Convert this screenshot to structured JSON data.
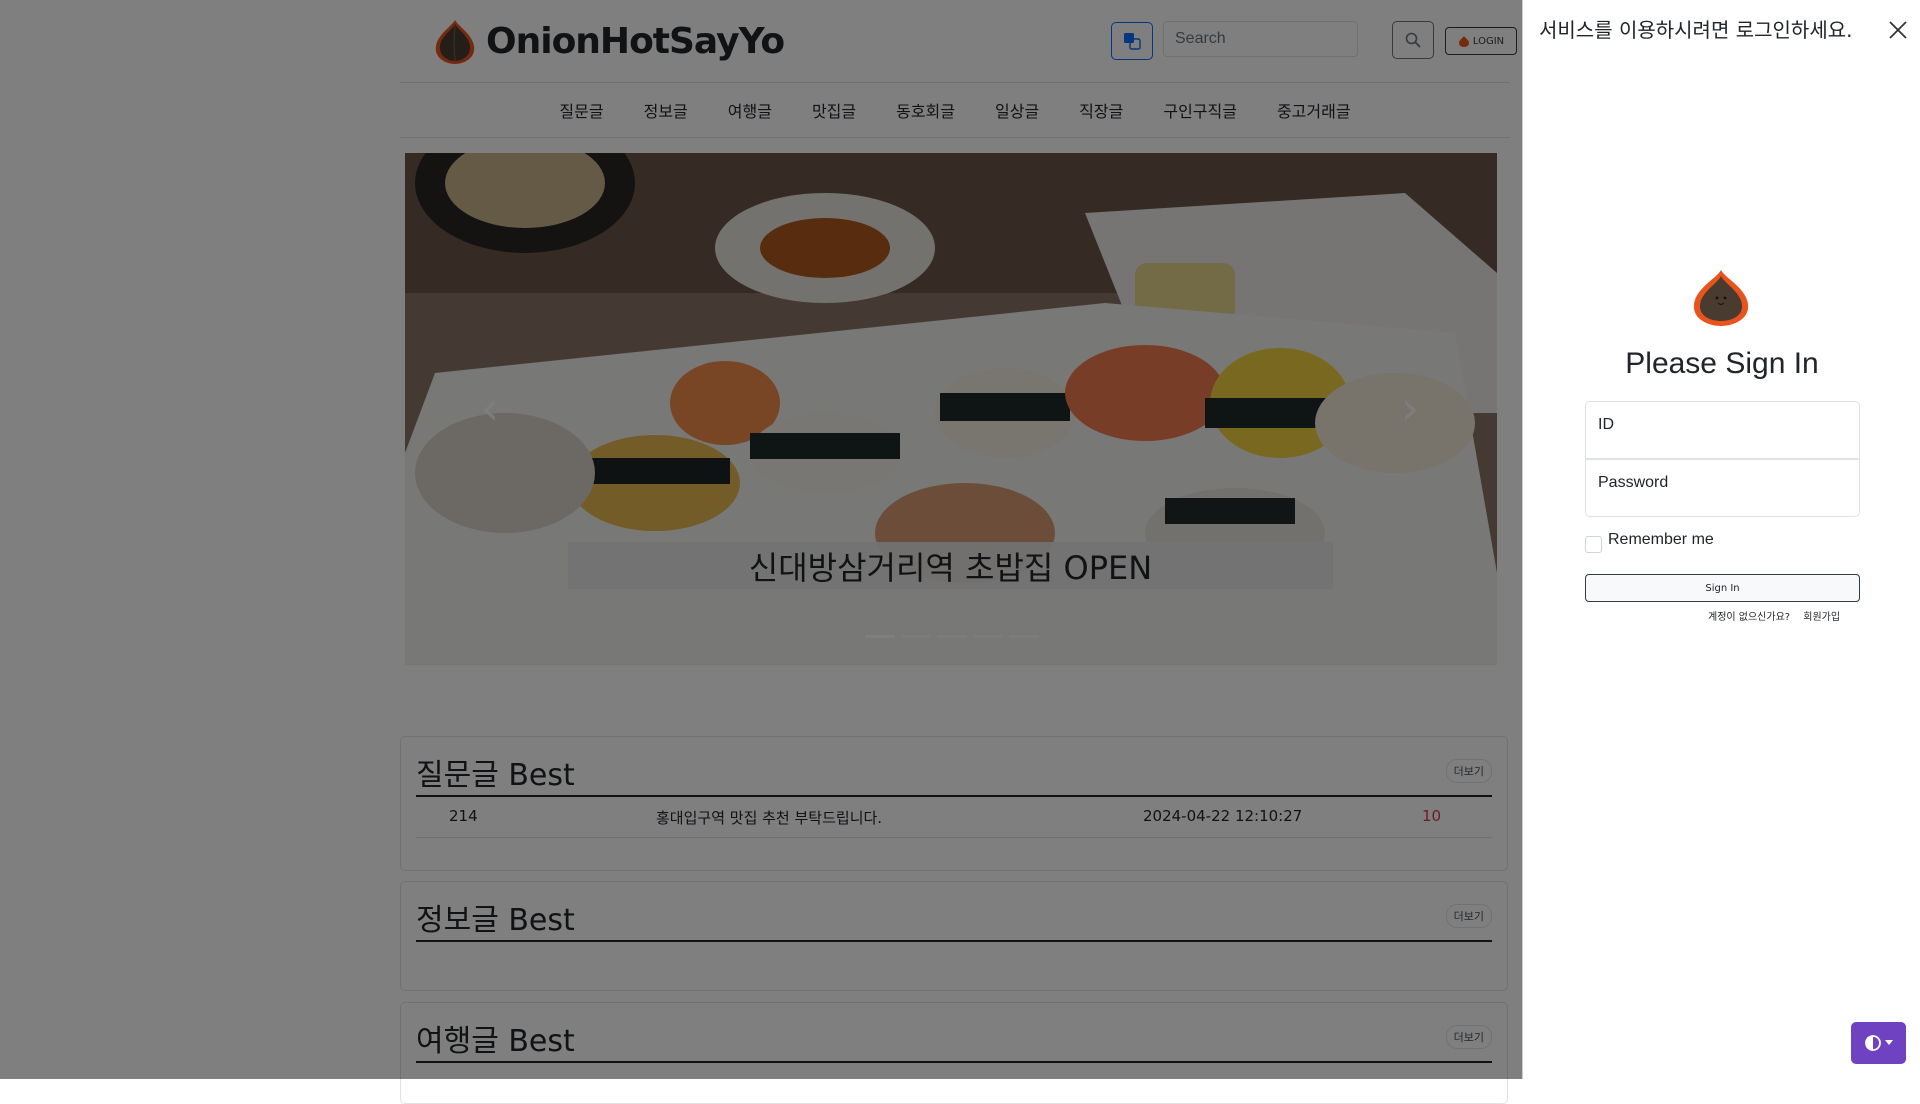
{
  "header": {
    "site_name": "OnionHotSayYo",
    "search_placeholder": "Search",
    "login_label": "LOGIN"
  },
  "nav": {
    "items": [
      "질문글",
      "정보글",
      "여행글",
      "맛집글",
      "동호회글",
      "일상글",
      "직장글",
      "구인구직글",
      "중고거래글"
    ]
  },
  "carousel": {
    "caption": "신대방삼거리역 초밥집 OPEN",
    "slide_count": 5,
    "active_index": 0
  },
  "sections": [
    {
      "title": "질문글 Best",
      "more_label": "더보기",
      "rows": [
        {
          "id": "214",
          "title": "홍대입구역 맛집 추천 부탁드립니다.",
          "date": "2024-04-22 12:10:27",
          "count": "10"
        }
      ]
    },
    {
      "title": "정보글 Best",
      "more_label": "더보기",
      "rows": []
    },
    {
      "title": "여행글 Best",
      "more_label": "더보기",
      "rows": []
    }
  ],
  "offcanvas": {
    "title": "서비스를 이용하시려면 로그인하세요.",
    "heading": "Please Sign In",
    "id_label": "ID",
    "password_label": "Password",
    "remember_label": "Remember me",
    "signin_label": "Sign In",
    "no_account_text": "계정이 없으신가요?",
    "signup_label": "회원가입"
  },
  "colors": {
    "accent_blue": "#0d6efd",
    "theme_button": "#6f42c1",
    "count_red": "#dc3545",
    "onion_orange": "#e8541c"
  },
  "icons": {
    "translate": "translate-icon",
    "search": "search-icon",
    "close": "close-icon",
    "theme": "contrast-icon"
  }
}
